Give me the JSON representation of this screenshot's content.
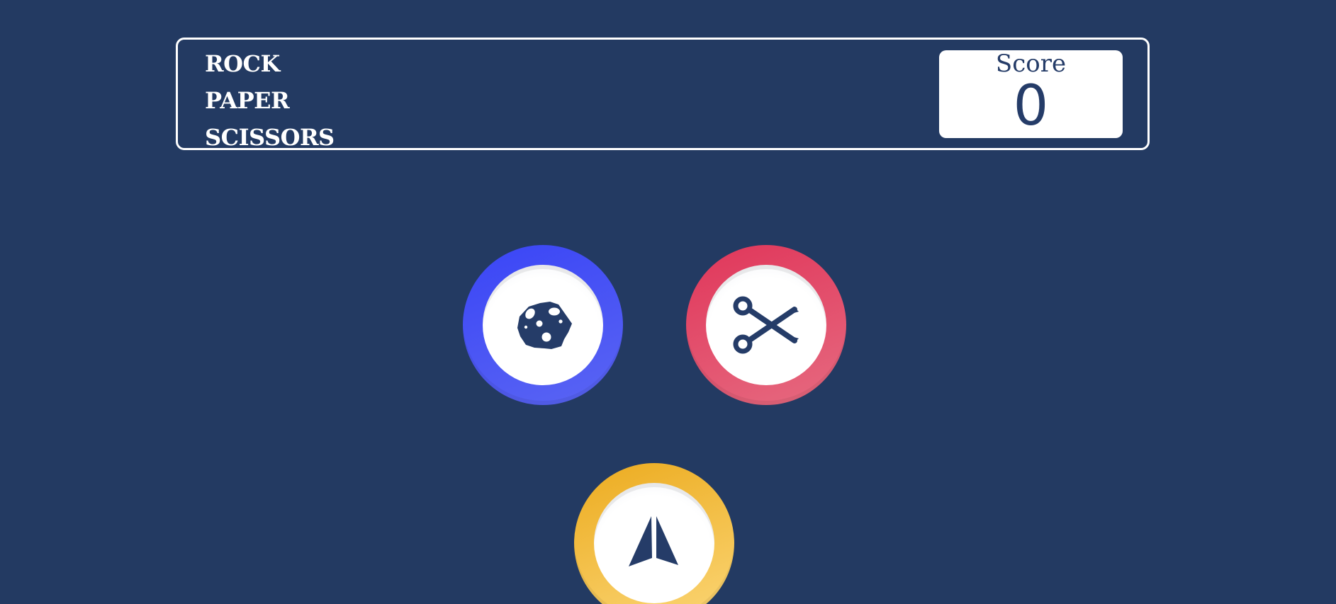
{
  "header": {
    "title_lines": [
      "ROCK",
      "PAPER",
      "SCISSORS"
    ]
  },
  "score": {
    "label": "Score",
    "value": "0"
  },
  "choices": [
    {
      "id": "rock",
      "icon": "rock-icon",
      "color": "#3b46f6"
    },
    {
      "id": "scissors",
      "icon": "scissors-icon",
      "color": "#e0365a"
    },
    {
      "id": "paper",
      "icon": "paper-plane-icon",
      "color": "#efb02a"
    }
  ],
  "colors": {
    "background": "#233a62",
    "icon": "#253c68",
    "rock_ring": "#3b46f6",
    "scissors_ring": "#e0365a",
    "paper_ring": "#efb02a"
  }
}
